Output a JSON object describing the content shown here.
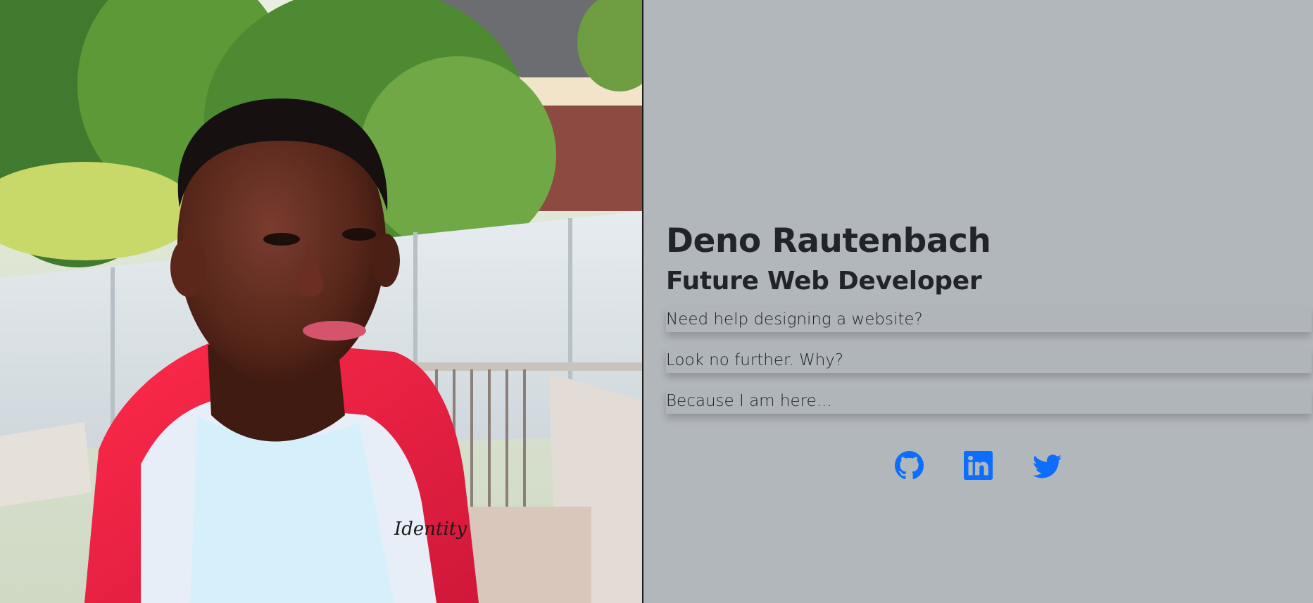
{
  "profile": {
    "photo_alt": "Portrait photo",
    "name": "Deno Rautenbach",
    "tagline": "Future Web Developer"
  },
  "pitch": {
    "lines": [
      "Need help designing a website?",
      "Look no further. Why?",
      "Because I am here..."
    ]
  },
  "social": {
    "icons": [
      "github-icon",
      "linkedin-icon",
      "twitter-icon"
    ],
    "accent_color": "#0d6efd"
  },
  "colors": {
    "page_background": "#b2b7bc",
    "text": "#212529"
  }
}
